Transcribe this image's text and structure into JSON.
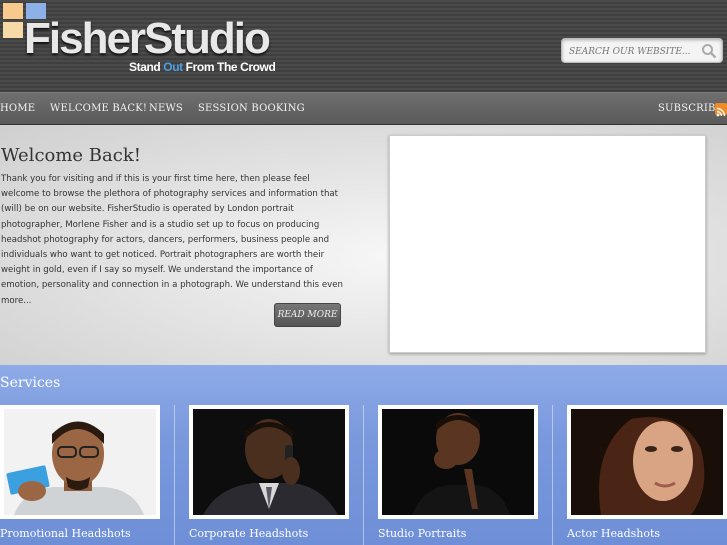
{
  "header": {
    "logo_text": "FisherStudio",
    "tagline_pre": "Stand ",
    "tagline_out": "Out",
    "tagline_post": " From The Crowd",
    "logo_colors": [
      "#f7c98c",
      "#8cb0e8",
      "#f7d9a8",
      "#c4c4c4"
    ],
    "search_placeholder": "SEARCH OUR WEBSITE..."
  },
  "nav": {
    "items": [
      "HOME",
      "WELCOME BACK!",
      "NEWS",
      "SESSION BOOKING"
    ],
    "subscribe": "SUBSCRIBE"
  },
  "feature": {
    "title": "Welcome Back!",
    "body": "Thank you for visiting and if this is your first time here, then please feel welcome to browse the plethora of photography services and information that (will) be on our website. FisherStudio is operated by London portrait photographer, Morlene Fisher and is a  studio set up to focus on producing headshot photography for actors, dancers, performers, business people and individuals who want to get noticed. Portrait photographers are worth their weight in gold, even if I say so myself. We understand the importance of emotion, personality and connection in a photograph. We understand this even more...",
    "read_more": "READ MORE"
  },
  "services": {
    "title": "Services",
    "items": [
      {
        "label": "Promotional Headshots"
      },
      {
        "label": "Corporate Headshots"
      },
      {
        "label": "Studio Portraits"
      },
      {
        "label": "Actor Headshots"
      }
    ]
  }
}
